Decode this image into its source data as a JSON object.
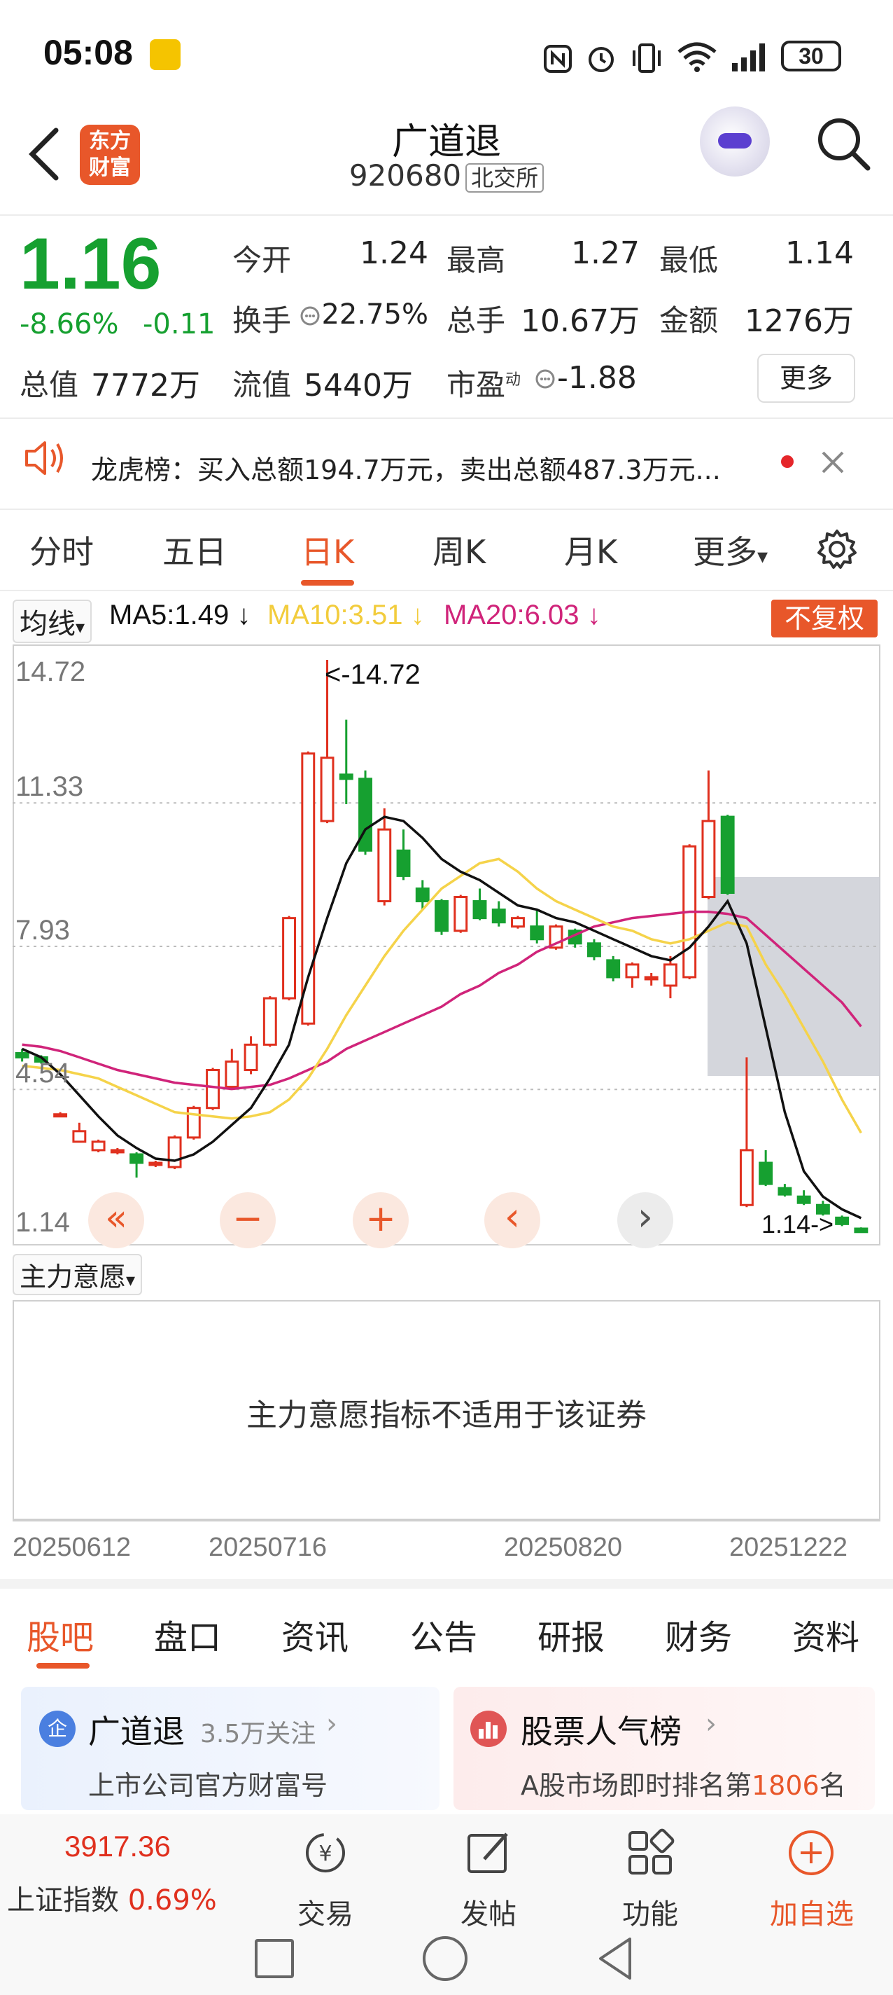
{
  "status_bar": {
    "time": "05:08",
    "battery": "30"
  },
  "header": {
    "brand_line1": "东方",
    "brand_line2": "财富",
    "title": "广道退",
    "code": "920680",
    "market": "北交所"
  },
  "quote": {
    "price": "1.16",
    "change_pct": "-8.66%",
    "change_amt": "-0.11",
    "open_label": "今开",
    "open": "1.24",
    "high_label": "最高",
    "high": "1.27",
    "low_label": "最低",
    "low": "1.14",
    "turnover_label": "换手",
    "turnover": "22.75%",
    "volume_label": "总手",
    "volume": "10.67万",
    "amount_label": "金额",
    "amount": "1276万",
    "mcap_label": "总值",
    "mcap": "7772万",
    "float_label": "流值",
    "float": "5440万",
    "pe_label": "市盈",
    "pe_sup": "动",
    "pe": "-1.88",
    "more": "更多"
  },
  "banner": {
    "text": "龙虎榜：买入总额194.7万元，卖出总额487.3万元..."
  },
  "period_tabs": [
    "分时",
    "五日",
    "日K",
    "周K",
    "月K",
    "更多"
  ],
  "ma_legend": {
    "selector": "均线",
    "ma5": "MA5:1.49",
    "ma10": "MA10:3.51",
    "ma20": "MA20:6.03",
    "fq": "不复权"
  },
  "chart_data": {
    "type": "candlestick",
    "y_ticks": [
      "14.72",
      "11.33",
      "7.93",
      "4.54",
      "1.14"
    ],
    "ylim": [
      1.14,
      14.72
    ],
    "annotations": {
      "high_marker": "<-14.72",
      "low_marker": "1.14->"
    },
    "x_labels": [
      "20250612",
      "20250716",
      "20250820",
      "20251222"
    ],
    "colors": {
      "up": "#e0301e",
      "down": "#16a030",
      "ma5": "#111111",
      "ma10": "#f5d34a",
      "ma20": "#d0247a"
    },
    "candles": [
      {
        "o": 5.4,
        "c": 5.3,
        "h": 5.5,
        "l": 5.2
      },
      {
        "o": 5.3,
        "c": 5.2,
        "h": 5.35,
        "l": 5.15
      },
      {
        "o": 3.95,
        "c": 3.95,
        "h": 4.0,
        "l": 3.9
      },
      {
        "o": 3.3,
        "c": 3.55,
        "h": 3.75,
        "l": 3.3
      },
      {
        "o": 3.1,
        "c": 3.3,
        "h": 3.35,
        "l": 3.05
      },
      {
        "o": 3.05,
        "c": 3.1,
        "h": 3.15,
        "l": 3.0
      },
      {
        "o": 3.0,
        "c": 2.8,
        "h": 3.05,
        "l": 2.45
      },
      {
        "o": 2.75,
        "c": 2.8,
        "h": 2.85,
        "l": 2.7
      },
      {
        "o": 2.7,
        "c": 3.4,
        "h": 3.45,
        "l": 2.65
      },
      {
        "o": 3.4,
        "c": 4.1,
        "h": 4.15,
        "l": 3.35
      },
      {
        "o": 4.1,
        "c": 5.0,
        "h": 5.05,
        "l": 4.05
      },
      {
        "o": 4.6,
        "c": 5.2,
        "h": 5.5,
        "l": 4.55
      },
      {
        "o": 5.0,
        "c": 5.6,
        "h": 5.8,
        "l": 4.9
      },
      {
        "o": 5.6,
        "c": 6.7,
        "h": 6.75,
        "l": 5.55
      },
      {
        "o": 6.7,
        "c": 8.6,
        "h": 8.65,
        "l": 6.65
      },
      {
        "o": 6.1,
        "c": 12.5,
        "h": 12.55,
        "l": 6.05
      },
      {
        "o": 10.9,
        "c": 12.4,
        "h": 14.72,
        "l": 10.85
      },
      {
        "o": 12.0,
        "c": 11.9,
        "h": 13.3,
        "l": 11.3
      },
      {
        "o": 11.9,
        "c": 10.2,
        "h": 12.1,
        "l": 10.1
      },
      {
        "o": 9.0,
        "c": 10.7,
        "h": 11.2,
        "l": 8.9
      },
      {
        "o": 10.2,
        "c": 9.6,
        "h": 10.7,
        "l": 9.5
      },
      {
        "o": 9.3,
        "c": 9.0,
        "h": 9.5,
        "l": 8.8
      },
      {
        "o": 9.0,
        "c": 8.3,
        "h": 9.05,
        "l": 8.2
      },
      {
        "o": 8.3,
        "c": 9.1,
        "h": 9.15,
        "l": 8.25
      },
      {
        "o": 9.0,
        "c": 8.6,
        "h": 9.3,
        "l": 8.55
      },
      {
        "o": 8.8,
        "c": 8.5,
        "h": 9.0,
        "l": 8.4
      },
      {
        "o": 8.4,
        "c": 8.6,
        "h": 8.65,
        "l": 8.35
      },
      {
        "o": 8.4,
        "c": 8.1,
        "h": 8.8,
        "l": 8.0
      },
      {
        "o": 7.9,
        "c": 8.4,
        "h": 8.45,
        "l": 7.85
      },
      {
        "o": 8.3,
        "c": 8.0,
        "h": 8.35,
        "l": 7.9
      },
      {
        "o": 8.0,
        "c": 7.7,
        "h": 8.1,
        "l": 7.6
      },
      {
        "o": 7.6,
        "c": 7.2,
        "h": 7.7,
        "l": 7.1
      },
      {
        "o": 7.2,
        "c": 7.5,
        "h": 7.55,
        "l": 6.95
      },
      {
        "o": 7.2,
        "c": 7.2,
        "h": 7.3,
        "l": 7.0
      },
      {
        "o": 7.0,
        "c": 7.5,
        "h": 7.7,
        "l": 6.7
      },
      {
        "o": 7.2,
        "c": 10.3,
        "h": 10.35,
        "l": 7.15
      },
      {
        "o": 9.1,
        "c": 10.9,
        "h": 12.1,
        "l": 9.05
      },
      {
        "o": 11.0,
        "c": 9.2,
        "h": 11.05,
        "l": 9.15
      },
      {
        "o": 1.8,
        "c": 3.1,
        "h": 5.3,
        "l": 1.75
      },
      {
        "o": 2.8,
        "c": 2.3,
        "h": 3.1,
        "l": 2.25
      },
      {
        "o": 2.2,
        "c": 2.05,
        "h": 2.3,
        "l": 2.0
      },
      {
        "o": 2.0,
        "c": 1.85,
        "h": 2.15,
        "l": 1.8
      },
      {
        "o": 1.8,
        "c": 1.6,
        "h": 1.9,
        "l": 1.55
      },
      {
        "o": 1.5,
        "c": 1.35,
        "h": 1.55,
        "l": 1.3
      },
      {
        "o": 1.24,
        "c": 1.16,
        "h": 1.27,
        "l": 1.14
      }
    ],
    "ma5": [
      5.5,
      5.3,
      4.9,
      4.4,
      3.9,
      3.45,
      3.15,
      2.9,
      2.85,
      3.0,
      3.3,
      3.7,
      4.1,
      4.8,
      5.6,
      7.2,
      8.6,
      9.9,
      10.7,
      11.0,
      10.9,
      10.5,
      10.0,
      9.7,
      9.5,
      9.2,
      8.9,
      8.8,
      8.6,
      8.5,
      8.3,
      8.1,
      7.9,
      7.7,
      7.6,
      7.9,
      8.4,
      9.0,
      8.0,
      6.0,
      4.0,
      2.6,
      2.0,
      1.7,
      1.49
    ],
    "ma10": [
      5.1,
      5.05,
      5.0,
      4.9,
      4.8,
      4.6,
      4.4,
      4.2,
      4.0,
      3.95,
      3.9,
      3.85,
      3.9,
      4.0,
      4.3,
      4.8,
      5.5,
      6.3,
      7.0,
      7.7,
      8.3,
      8.8,
      9.3,
      9.6,
      9.9,
      10.0,
      9.7,
      9.3,
      9.0,
      8.8,
      8.6,
      8.4,
      8.3,
      8.1,
      8.0,
      8.1,
      8.3,
      8.5,
      8.4,
      7.5,
      6.8,
      6.0,
      5.2,
      4.3,
      3.51
    ],
    "ma20": [
      5.6,
      5.55,
      5.45,
      5.3,
      5.15,
      5.0,
      4.9,
      4.8,
      4.7,
      4.65,
      4.6,
      4.55,
      4.6,
      4.65,
      4.8,
      5.0,
      5.2,
      5.5,
      5.7,
      5.9,
      6.1,
      6.3,
      6.5,
      6.8,
      7.0,
      7.3,
      7.5,
      7.8,
      8.0,
      8.2,
      8.4,
      8.5,
      8.6,
      8.65,
      8.7,
      8.75,
      8.75,
      8.7,
      8.6,
      8.2,
      7.8,
      7.4,
      7.0,
      6.6,
      6.03
    ]
  },
  "chart_controls": [
    "«",
    "−",
    "+",
    "‹",
    "›"
  ],
  "indicator": {
    "selector": "主力意愿",
    "message": "主力意愿指标不适用于该证券"
  },
  "bottom_tabs": [
    "股吧",
    "盘口",
    "资讯",
    "公告",
    "研报",
    "财务",
    "资料"
  ],
  "cards": [
    {
      "badge": "企",
      "title": "广道退",
      "meta": "3.5万关注",
      "subtitle": "上市公司官方财富号"
    },
    {
      "title": "股票人气榜",
      "subtitle_prefix": "A股市场即时排名第",
      "rank": "1806",
      "subtitle_suffix": "名"
    }
  ],
  "index": {
    "value": "3917.36",
    "name": "上证指数",
    "change": "0.69%"
  },
  "bottom_nav": [
    "交易",
    "发帖",
    "功能",
    "加自选"
  ]
}
